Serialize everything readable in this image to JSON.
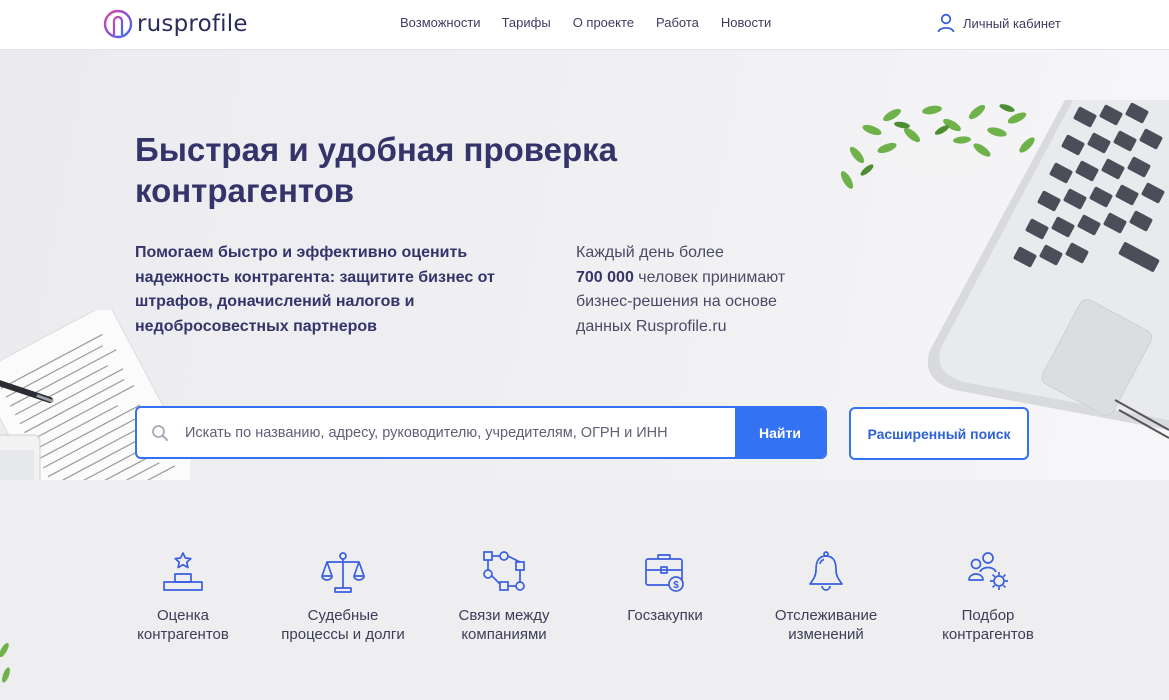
{
  "brand": {
    "name": "rusprofile",
    "accent": "#3372f2",
    "text_dark": "#34346a"
  },
  "nav": {
    "items": [
      "Возможности",
      "Тарифы",
      "О проекте",
      "Работа",
      "Новости"
    ],
    "account_label": "Личный кабинет"
  },
  "hero": {
    "title": "Быстрая и удобная проверка контрагентов",
    "description": "Помогаем быстро и эффективно оценить надежность контрагента: защитите бизнес от штрафов, доначислений налогов и недобросовестных партнеров",
    "stats_prefix": "Каждый день более",
    "stats_number": "700 000",
    "stats_suffix": "человек принимают бизнес-решения на основе данных Rusprofile.ru"
  },
  "search": {
    "placeholder": "Искать по названию, адресу, руководителю, учредителям, ОГРН и ИНН",
    "value": "",
    "button_label": "Найти",
    "advanced_label": "Расширенный поиск"
  },
  "features": [
    {
      "icon": "podium-star-icon",
      "label": "Оценка\nконтрагентов"
    },
    {
      "icon": "scales-icon",
      "label": "Судебные\nпроцессы и долги"
    },
    {
      "icon": "network-icon",
      "label": "Связи между\nкомпаниями"
    },
    {
      "icon": "briefcase-dollar-icon",
      "label": "Госзакупки"
    },
    {
      "icon": "bell-icon",
      "label": "Отслеживание\nизменений"
    },
    {
      "icon": "people-gear-icon",
      "label": "Подбор\nконтрагентов"
    }
  ]
}
